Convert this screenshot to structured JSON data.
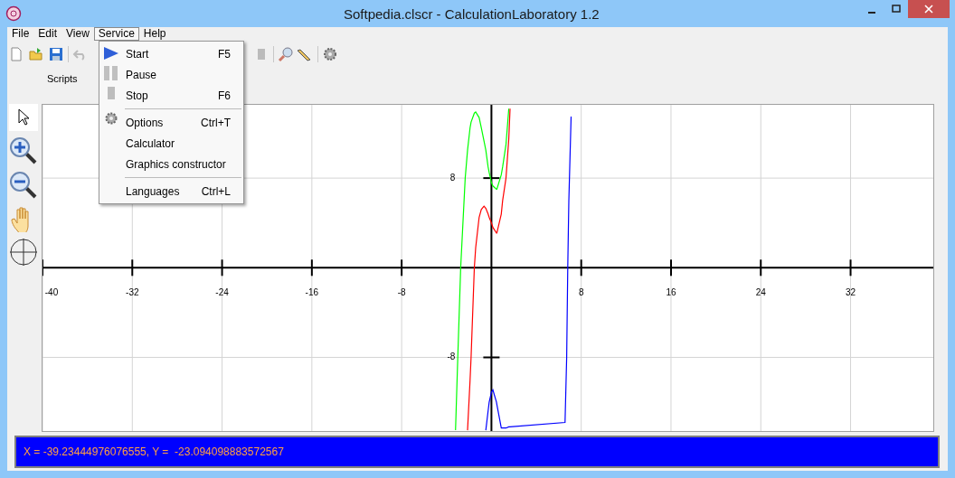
{
  "window": {
    "title": "Softpedia.clscr - CalculationLaboratory 1.2"
  },
  "menu_bar": [
    {
      "label": "File",
      "selected": false
    },
    {
      "label": "Edit",
      "selected": false
    },
    {
      "label": "View",
      "selected": false
    },
    {
      "label": "Service",
      "selected": true
    },
    {
      "label": "Help",
      "selected": false
    }
  ],
  "dropdown": [
    {
      "kind": "item",
      "label": "Start",
      "shortcut": "F5"
    },
    {
      "kind": "item",
      "label": "Pause"
    },
    {
      "kind": "item",
      "label": "Stop",
      "shortcut": "F6"
    },
    {
      "kind": "separator"
    },
    {
      "kind": "item",
      "label": "Options",
      "shortcut": "Ctrl+T"
    },
    {
      "kind": "item",
      "label": "Calculator"
    },
    {
      "kind": "item",
      "label": "Graphics constructor"
    },
    {
      "kind": "separator"
    },
    {
      "kind": "item",
      "label": "Languages",
      "shortcut": "Ctrl+L"
    }
  ],
  "tabs": [
    {
      "label": "Scripts",
      "selected": true
    }
  ],
  "plot": {
    "chart_data": {
      "type": "line",
      "x": [
        -3.2,
        -3.0,
        -2.74,
        -2.34,
        -2.13,
        -1.9,
        -1.81,
        -1.52,
        -1.4,
        -1.1,
        -0.9,
        -0.66,
        -0.5,
        -0.3,
        -0.2,
        0,
        0.13,
        0.45,
        0.48,
        0.88,
        1.0,
        1.3,
        1.55,
        1.66,
        6.56,
        6.7,
        6.8,
        6.9,
        7.1
      ],
      "series": [
        {
          "color": "#00ff00",
          "values": [
            -14.5,
            -8,
            0,
            8,
            10.5,
            12.5,
            13,
            13.8,
            13.9,
            13.4,
            12.5,
            11.3,
            10.5,
            9,
            8.5,
            7.6,
            7.3,
            7.0,
            7.0,
            8.3,
            9,
            11,
            14.2,
            null,
            null,
            null,
            null,
            null,
            null
          ]
        },
        {
          "color": "#ff0000",
          "values": [
            null,
            null,
            null,
            null,
            -14.5,
            -10,
            -8,
            0,
            1.8,
            4.5,
            5.2,
            5.5,
            5.3,
            4.8,
            4.5,
            4,
            3.6,
            3.1,
            3.1,
            4.8,
            6,
            8,
            11.5,
            14.2,
            null,
            null,
            null,
            null,
            null
          ]
        },
        {
          "color": "#0000ff",
          "values": [
            null,
            null,
            null,
            null,
            null,
            null,
            null,
            null,
            null,
            null,
            null,
            null,
            -14.5,
            -12.8,
            -12,
            -11.1,
            -10.9,
            -12,
            -12.2,
            -14.3,
            -14.3,
            -14.3,
            -14.2,
            -14.2,
            -13.8,
            -8,
            0,
            6,
            13.5
          ]
        }
      ],
      "grid": true,
      "xlim": [
        -40,
        39.37
      ],
      "ylim": [
        -14.57,
        14.54
      ],
      "xticks": [
        -40,
        -32,
        -24,
        -16,
        -8,
        8,
        16,
        24,
        32
      ],
      "yticks": [
        8,
        -8
      ]
    }
  },
  "status_bar": {
    "text": "X = -39.23444976076555, Y =  -23.094098883572567"
  }
}
